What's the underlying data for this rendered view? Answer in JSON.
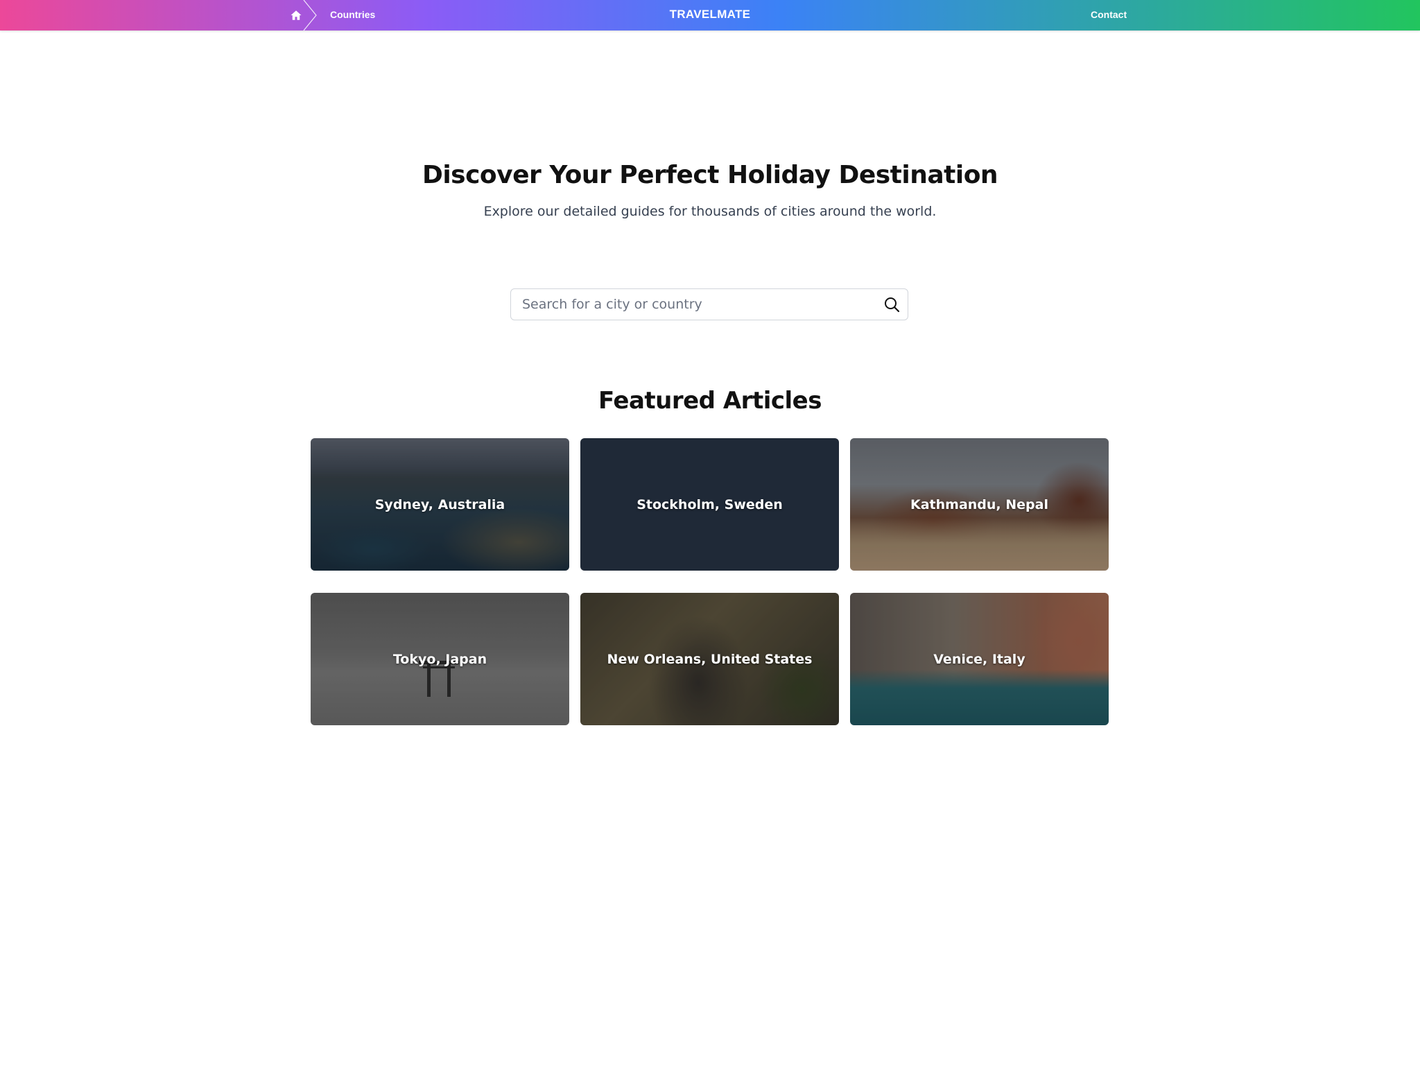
{
  "nav": {
    "home_icon": "home-icon",
    "countries_label": "Countries",
    "brand": "TRAVELMATE",
    "contact_label": "Contact"
  },
  "hero": {
    "title": "Discover Your Perfect Holiday Destination",
    "subtitle": "Explore our detailed guides for thousands of cities around the world."
  },
  "search": {
    "placeholder": "Search for a city or country",
    "value": "",
    "icon": "search-icon"
  },
  "featured": {
    "title": "Featured Articles",
    "articles": [
      {
        "label": "Sydney, Australia"
      },
      {
        "label": "Stockholm, Sweden"
      },
      {
        "label": "Kathmandu, Nepal"
      },
      {
        "label": "Tokyo, Japan"
      },
      {
        "label": "New Orleans, United States"
      },
      {
        "label": "Venice, Italy"
      }
    ]
  },
  "colors": {
    "gradient_start": "#ec4899",
    "gradient_mid": "#3b82f6",
    "gradient_end": "#22c55e",
    "card_dark": "#1f2937"
  }
}
